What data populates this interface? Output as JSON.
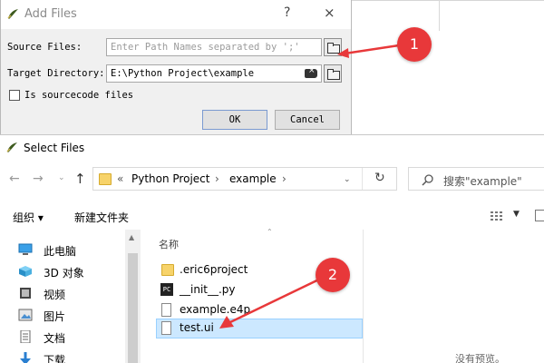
{
  "add_files": {
    "title": "Add Files",
    "help": "?",
    "close": "×",
    "source_label": "Source Files:",
    "source_placeholder": "Enter Path Names separated by ';'",
    "target_label": "Target Directory:",
    "target_value": "E:\\Python Project\\example",
    "sourcecode_label": "Is sourcecode files",
    "ok_label": "OK",
    "cancel_label": "Cancel"
  },
  "select_files": {
    "title": "Select Files",
    "breadcrumb": [
      "«",
      "Python Project",
      "›",
      "example",
      "›"
    ],
    "search_placeholder": "搜索\"example\"",
    "organize_label": "组织 ▾",
    "new_folder_label": "新建文件夹",
    "nav_items": [
      {
        "label": "此电脑",
        "icon": "computer-icon"
      },
      {
        "label": "3D 对象",
        "icon": "cube-icon"
      },
      {
        "label": "视频",
        "icon": "video-icon"
      },
      {
        "label": "图片",
        "icon": "picture-icon"
      },
      {
        "label": "文档",
        "icon": "document-icon"
      },
      {
        "label": "下载",
        "icon": "download-icon"
      }
    ],
    "column_name": "名称",
    "files": [
      {
        "name": ".eric6project",
        "icon": "folder-icon"
      },
      {
        "name": "__init__.py",
        "icon": "python-icon"
      },
      {
        "name": "example.e4p",
        "icon": "file-icon"
      },
      {
        "name": "test.ui",
        "icon": "file-icon",
        "selected": true
      }
    ],
    "preview_text": "没有预览。"
  },
  "callouts": [
    "1",
    "2"
  ],
  "colors": {
    "accent_red": "#e8383a",
    "selection": "#cce8ff"
  }
}
